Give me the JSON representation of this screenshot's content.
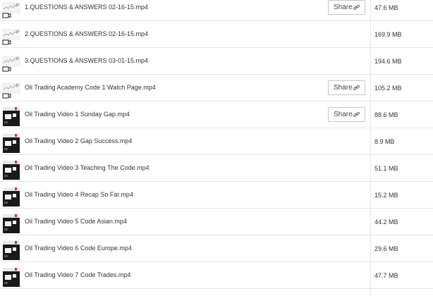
{
  "files": [
    {
      "name": "1.QUESTIONS & ANSWERS 02-16-15.mp4",
      "size": "47.6 MB",
      "share": true,
      "thumb": "chart"
    },
    {
      "name": "2.QUESTIONS & ANSWERS 02-16-15.mp4",
      "size": "169.9 MB",
      "share": false,
      "thumb": "chart"
    },
    {
      "name": "3.QUESTIONS & ANSWERS 03-01-15.mp4",
      "size": "194.6 MB",
      "share": false,
      "thumb": "chart"
    },
    {
      "name": "Oil Trading Academy Code 1 Watch Page.mp4",
      "size": "105.2 MB",
      "share": true,
      "thumb": "chart"
    },
    {
      "name": "Oil Trading Video 1 Sunday Gap.mp4",
      "size": "88.6 MB",
      "share": true,
      "thumb": "dark"
    },
    {
      "name": "Oil Trading Video 2 Gap Success.mp4",
      "size": "8.9 MB",
      "share": false,
      "thumb": "dark"
    },
    {
      "name": "Oil Trading Video 3 Teaching The Code.mp4",
      "size": "51.1 MB",
      "share": false,
      "thumb": "dark"
    },
    {
      "name": "Oil Trading Video 4 Recap So Far.mp4",
      "size": "15.2 MB",
      "share": false,
      "thumb": "dark"
    },
    {
      "name": "Oil Trading Video 5 Code Asian.mp4",
      "size": "44.2 MB",
      "share": false,
      "thumb": "dark"
    },
    {
      "name": "Oil Trading Video 6 Code Europe.mp4",
      "size": "29.6 MB",
      "share": false,
      "thumb": "dark"
    },
    {
      "name": "Oil Trading Video 7 Code Trades.mp4",
      "size": "47.7 MB",
      "share": false,
      "thumb": "dark"
    }
  ],
  "share_label": "Share",
  "icons": {
    "share_button_icon": "link-icon",
    "video_badge_icon": "video-camera-icon"
  },
  "colors": {
    "row_border": "#e6e6e6",
    "button_border": "#c6c6c6",
    "text": "#333333",
    "thumb_dark": "#1a1a1a",
    "thumb_accent": "#cc3333"
  }
}
